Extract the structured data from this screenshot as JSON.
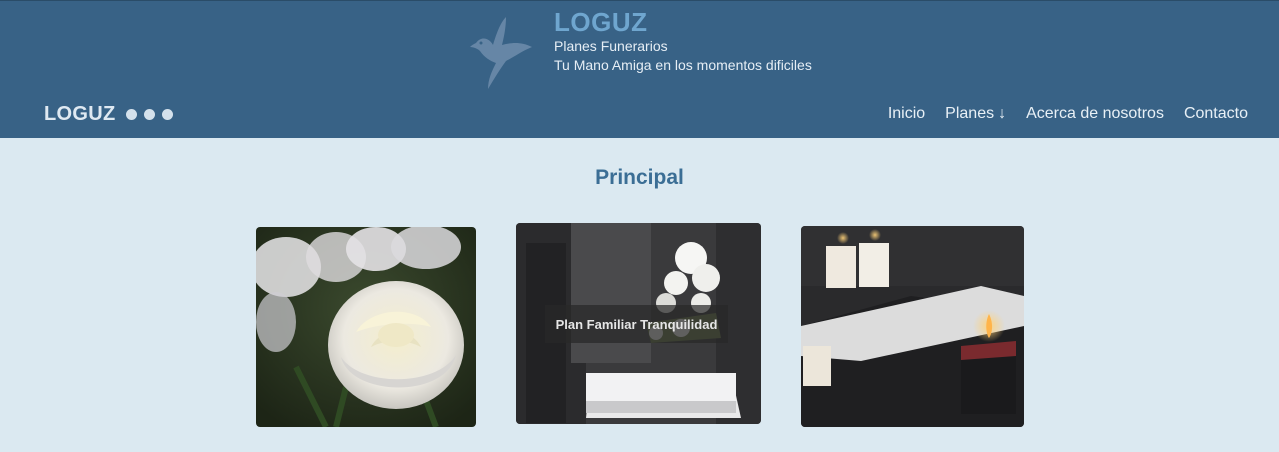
{
  "header": {
    "title": "LOGUZ",
    "subtitle1": "Planes Funerarios",
    "subtitle2": "Tu Mano Amiga en los momentos dificiles",
    "logo_icon": "dove-icon"
  },
  "navbar": {
    "logo_text": "LOGUZ",
    "items": [
      {
        "label": "Inicio"
      },
      {
        "label": "Planes",
        "icon": "arrow-down-icon",
        "arrow": "↓"
      },
      {
        "label": "Acerca de nosotros"
      },
      {
        "label": "Contacto"
      }
    ]
  },
  "main": {
    "title": "Principal",
    "cards": [
      {
        "image": "white-rose-image"
      },
      {
        "image": "coffin-flowers-image",
        "caption": "Plan Familiar Tranquilidad"
      },
      {
        "image": "candles-image"
      }
    ]
  },
  "colors": {
    "header_bg": "#386286",
    "page_bg": "#dbe9f1",
    "title_accent": "#3b6e95"
  }
}
